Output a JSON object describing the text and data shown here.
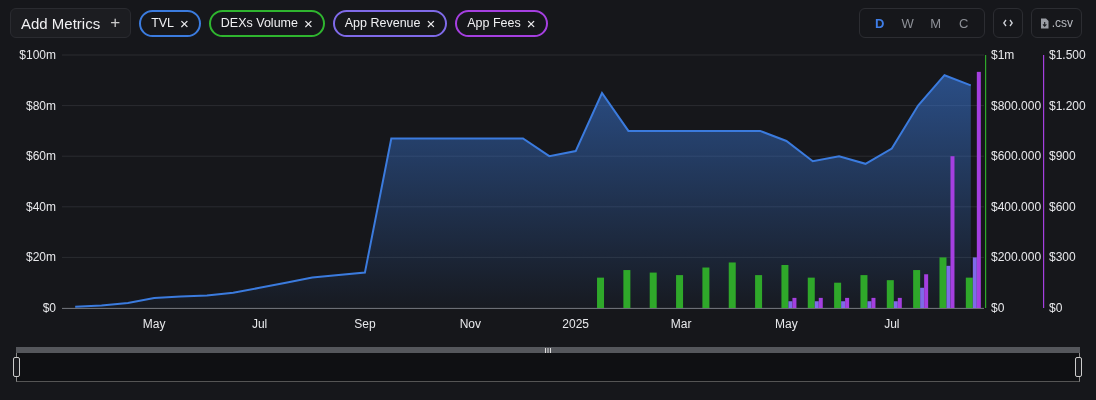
{
  "toolbar": {
    "add_metrics": {
      "label": "Add Metrics",
      "icon": "+"
    },
    "metrics": [
      {
        "label": "TVL",
        "color": "#3b7bde"
      },
      {
        "label": "DEXs Volume",
        "color": "#2fb52f"
      },
      {
        "label": "App Revenue",
        "color": "#7f6ae8"
      },
      {
        "label": "App Fees",
        "color": "#a53fe0"
      }
    ],
    "remove_icon": "×",
    "intervals": [
      {
        "label": "D",
        "selected": true
      },
      {
        "label": "W",
        "selected": false
      },
      {
        "label": "M",
        "selected": false
      },
      {
        "label": "C",
        "selected": false
      }
    ],
    "csv_button": ".csv"
  },
  "chart": {
    "chart_data": {
      "type": "area",
      "ylim": [
        0,
        100
      ],
      "grid": true,
      "categories": [
        null,
        null,
        null,
        "May",
        null,
        null,
        null,
        "Jul",
        null,
        null,
        null,
        "Sep",
        null,
        null,
        null,
        "Nov",
        null,
        null,
        null,
        "2025",
        null,
        null,
        null,
        "Mar",
        null,
        null,
        null,
        "May",
        null,
        null,
        null,
        "Jul",
        null,
        null,
        null
      ],
      "yticks": [
        {
          "value": 0,
          "label": "$0"
        },
        {
          "value": 20,
          "label": "$20m"
        },
        {
          "value": 40,
          "label": "$40m"
        },
        {
          "value": 60,
          "label": "$60m"
        },
        {
          "value": 80,
          "label": "$80m"
        },
        {
          "value": 100,
          "label": "$100m"
        }
      ],
      "series": [
        {
          "color": "#3b7bde",
          "values": [
            0.5,
            1,
            2,
            4,
            4.5,
            5,
            6,
            8,
            10,
            12,
            13,
            14,
            67,
            67,
            67,
            67,
            67,
            67,
            60,
            62,
            85,
            70,
            70,
            70,
            70,
            70,
            70,
            66,
            58,
            60,
            57,
            63,
            80,
            92,
            88
          ]
        }
      ]
    }
  },
  "volume_overlay": {
    "chart_data": {
      "type": "bar",
      "ylim": [
        0,
        1000000
      ],
      "categories": [
        null,
        null,
        null,
        null,
        null,
        null,
        null,
        null,
        null,
        null,
        null,
        null,
        null,
        null,
        null,
        null,
        null,
        null,
        null,
        null,
        null,
        null,
        null,
        null,
        null,
        null,
        null,
        null,
        null,
        null,
        null,
        null,
        null,
        null,
        null
      ],
      "yticks": [
        {
          "value": 0,
          "label": "$0"
        },
        {
          "value": 200000,
          "label": "$200.000"
        },
        {
          "value": 400000,
          "label": "$400.000"
        },
        {
          "value": 600000,
          "label": "$600.000"
        },
        {
          "value": 800000,
          "label": "$800.000"
        },
        {
          "value": 1000000,
          "label": "$1m"
        }
      ],
      "series": [
        {
          "color": "#2fa82a",
          "values": [
            null,
            null,
            null,
            null,
            null,
            null,
            null,
            null,
            null,
            null,
            null,
            null,
            null,
            null,
            null,
            null,
            null,
            null,
            null,
            null,
            120000,
            150000,
            140000,
            130000,
            160000,
            180000,
            130000,
            170000,
            120000,
            100000,
            130000,
            110000,
            150000,
            200000,
            120000
          ]
        }
      ]
    }
  },
  "fees_overlay": {
    "chart_data": {
      "type": "bar",
      "ylim": [
        0,
        1500
      ],
      "categories": [
        null,
        null,
        null,
        null,
        null,
        null,
        null,
        null,
        null,
        null,
        null,
        null,
        null,
        null,
        null,
        null,
        null,
        null,
        null,
        null,
        null,
        null,
        null,
        null,
        null,
        null,
        null,
        null,
        null,
        null,
        null,
        null,
        null,
        null,
        null
      ],
      "yticks": [
        {
          "value": 0,
          "label": "$0"
        },
        {
          "value": 300,
          "label": "$300"
        },
        {
          "value": 600,
          "label": "$600"
        },
        {
          "value": 900,
          "label": "$900"
        },
        {
          "value": 1200,
          "label": "$1.200"
        },
        {
          "value": 1500,
          "label": "$1.500"
        }
      ],
      "series": [
        {
          "color": "#7f6ae8",
          "values": [
            null,
            null,
            null,
            null,
            null,
            null,
            null,
            null,
            null,
            null,
            null,
            null,
            null,
            null,
            null,
            null,
            null,
            null,
            null,
            null,
            null,
            null,
            null,
            null,
            null,
            null,
            null,
            40,
            40,
            40,
            40,
            40,
            120,
            250,
            300
          ]
        },
        {
          "color": "#a53fe0",
          "values": [
            null,
            null,
            null,
            null,
            null,
            null,
            null,
            null,
            null,
            null,
            null,
            null,
            null,
            null,
            null,
            null,
            null,
            null,
            null,
            null,
            null,
            null,
            null,
            null,
            null,
            null,
            null,
            60,
            60,
            60,
            60,
            60,
            200,
            900,
            1400
          ]
        }
      ]
    }
  },
  "range_slider": {
    "handles": [
      {
        "level": 0
      },
      {
        "level": 1
      }
    ]
  }
}
